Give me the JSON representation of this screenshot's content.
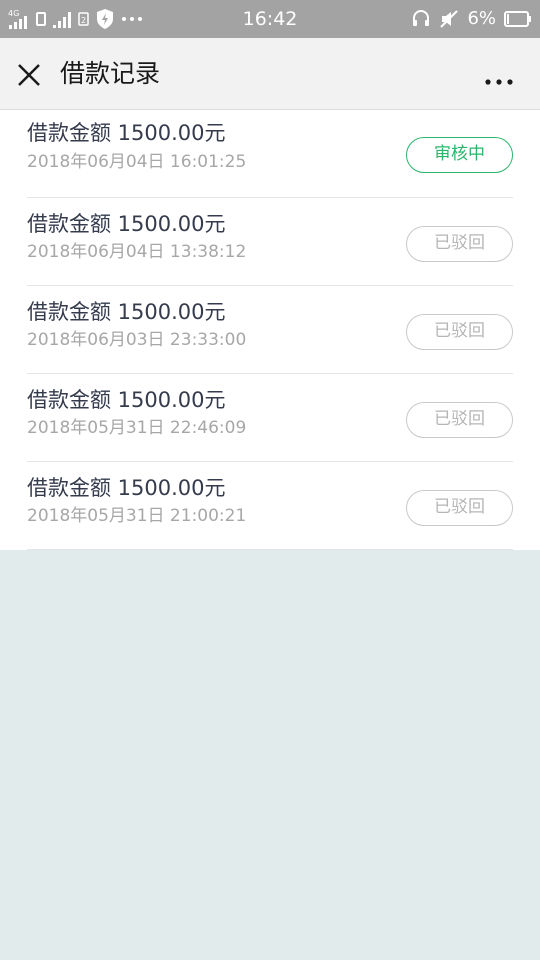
{
  "status_bar": {
    "time": "16:42",
    "battery": "6%",
    "left_icons": [
      "4g-signal-icon",
      "sim-icon",
      "signal-icon",
      "sim2-icon",
      "shield-bolt-icon",
      "more-dots-icon"
    ],
    "right_icons": [
      "headset-icon",
      "mute-icon",
      "battery-icon"
    ]
  },
  "nav": {
    "title": "借款记录",
    "close_icon": "close-icon",
    "more_icon": "more-icon"
  },
  "records": [
    {
      "amount": "借款金额 1500.00元",
      "datetime": "2018年06月04日 16:01:25",
      "status": "审核中",
      "status_type": "pending"
    },
    {
      "amount": "借款金额 1500.00元",
      "datetime": "2018年06月04日 13:38:12",
      "status": "已驳回",
      "status_type": "rejected"
    },
    {
      "amount": "借款金额 1500.00元",
      "datetime": "2018年06月03日 23:33:00",
      "status": "已驳回",
      "status_type": "rejected"
    },
    {
      "amount": "借款金额 1500.00元",
      "datetime": "2018年05月31日 22:46:09",
      "status": "已驳回",
      "status_type": "rejected"
    },
    {
      "amount": "借款金额 1500.00元",
      "datetime": "2018年05月31日 21:00:21",
      "status": "已驳回",
      "status_type": "rejected"
    }
  ],
  "colors": {
    "status_bar_bg": "#a3a3a3",
    "nav_bg": "#f2f2f2",
    "page_bg": "#e2ebec",
    "accent_green": "#2bb56a",
    "rejected_gray": "#b5b5b5"
  }
}
